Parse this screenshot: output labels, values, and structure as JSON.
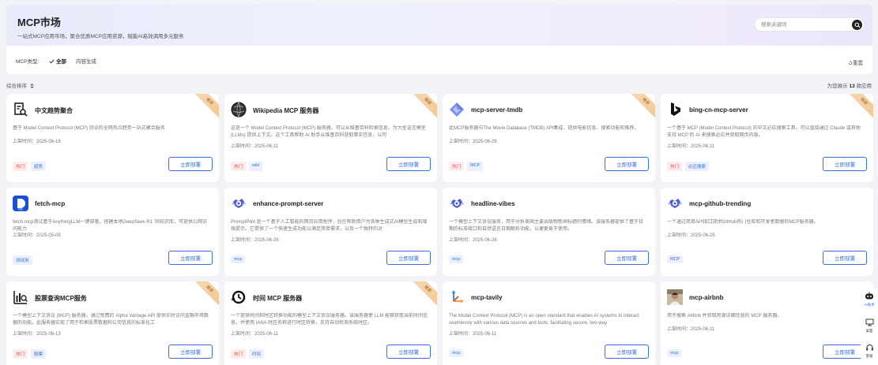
{
  "header": {
    "title": "MCP市场",
    "subtitle": "一站式MCP应用市场，聚合优质MCP应用资源，赋能AI高效调用多元服务",
    "search_placeholder": "搜索关键词"
  },
  "filter": {
    "label": "MCP类型:",
    "options": [
      {
        "label": "全部",
        "selected": true
      },
      {
        "label": "内容生成",
        "selected": false
      }
    ],
    "reset_label": "重置"
  },
  "sort_label": "综合排序",
  "count": {
    "prefix": "为您展示",
    "value": "13",
    "suffix": "款应用"
  },
  "cards": [
    {
      "title": "中文趋势聚合",
      "desc": "基于 Model Context Protocol (MCP) 协议的全网热点趋势一站式聚合服务",
      "date": "上架时间：2025-06-16",
      "tags": [
        "热门",
        "趋势"
      ],
      "ribbon": "推荐",
      "button": "立即部署",
      "icon": "trend-search-icon"
    },
    {
      "title": "Wikipedia MCP 服务器",
      "desc": "这是一个 Model Context Protocol (MCP) 服务器，可以从维基百科检索信息，为大型语言模型 (LLMs) 提供上下文。这个工具帮助 AI 助手从维基百科获取事实信息，以可",
      "date": "上架时间：2025-06-11",
      "tags": [
        "热门",
        "wiki"
      ],
      "ribbon": "推荐",
      "button": "立即部署",
      "icon": "wikipedia-globe-icon"
    },
    {
      "title": "mcp-server-tmdb",
      "desc": "此MCP服务器与The Movie Database (TMDB) API集成，提供电影信息、搜索功能和推荐。",
      "date": "上架时间：2025-06-26",
      "tags": [
        "热门",
        "MCP"
      ],
      "ribbon": "推荐",
      "button": "立即部署",
      "icon": "cube-icon"
    },
    {
      "title": "bing-cn-mcp-server",
      "desc": "一个基于 MCP (Model Context Protocol) 的中文必应搜索工具，可以直接通过 Claude 或其他支持 MCP 的 AI 来搜索必应并获取网页内容。",
      "date": "上架时间：2025-06-11",
      "tags": [
        "热门",
        "必应搜索"
      ],
      "ribbon": "推荐",
      "button": "立即部署",
      "icon": "bing-logo-icon"
    },
    {
      "title": "fetch-mcp",
      "desc": "fetch-mcp测试基于AnythingLLM一键部署，搭建本地DeepSeek-R1 7B知识库，可提供公网访问能力",
      "date": "上架时间：2025-05-09",
      "tags": [
        "测试用"
      ],
      "ribbon": "",
      "button": "立即部署",
      "icon": "dify-logo-icon"
    },
    {
      "title": "enhance-prompt-server",
      "desc": "PromptPilot 是一个基于人工智能的网页应用程序，旨在帮助用户为各种生成式AI模型生成和增强提示。它提供了一个快速生成功能以满足简单需求，以及一个独特的对",
      "date": "上架时间：2025-06-26",
      "tags": [
        "mcp"
      ],
      "ribbon": "",
      "button": "立即部署",
      "icon": "gear-cloud-icon"
    },
    {
      "title": "headline-vibes",
      "desc": "一个模型上下文协议服务，用于分析美国主要出版物新闻标题的情绪。该服务器提供了基于日期的标准接口和自然语言日期解析功能，以便更易于使用。",
      "date": "上架时间：2025-06-26",
      "tags": [
        "mcp"
      ],
      "ribbon": "",
      "button": "立即部署",
      "icon": "gear-cloud-icon"
    },
    {
      "title": "mcp-github-trending",
      "desc": "一个通过简单API接口提供GitHub热门仓库和开发者数据的MCP服务器。",
      "date": "上架时间：2025-06-25",
      "tags": [
        "MCP"
      ],
      "ribbon": "",
      "button": "立即部署",
      "icon": "gear-cloud-icon"
    },
    {
      "title": "股票查询MCP服务",
      "desc": "一个模型上下文协议 (MCP) 服务器，通过免费的 Alpha Vantage API 提供实时访问金融市场数据的功能。此服务器实现了用于检索股票数据和公司信息的标准化工",
      "date": "上架时间：2025-06-13",
      "tags": [
        "热门",
        "股票"
      ],
      "ribbon": "推荐",
      "button": "立即部署",
      "icon": "stock-chart-icon"
    },
    {
      "title": "时间 MCP 服务器",
      "desc": "一个提供时间和时区转换功能的模型上下文协议服务器。该服务器使 LLM 能够获取当前时间信息，并使用 IANA 时区名称进行时区转换，支持自动检测系统时区。",
      "date": "上架时间：2025-06-11",
      "tags": [
        "热门",
        "时间"
      ],
      "ribbon": "推荐",
      "button": "立即部署",
      "icon": "clock-icon"
    },
    {
      "title": "mcp-tavily",
      "desc": "The Model Context Protocol (MCP) is an open standard that enables AI systems to interact seamlessly with various data sources and tools, facilitating secure, two-way",
      "date": "上架时间：2025-06-11",
      "tags": [
        "mcp"
      ],
      "ribbon": "",
      "button": "立即部署",
      "icon": "tavily-logo-icon"
    },
    {
      "title": "mcp-airbnb",
      "desc": "用于搜索 Airbnb 并获取房源详细信息的 MCP 服务器。",
      "date": "上架时间：2025-06-11",
      "tags": [
        "mcp"
      ],
      "ribbon": "",
      "button": "立即部署",
      "icon": "avatar-photo-icon"
    }
  ],
  "rail": [
    {
      "label": "AI助手",
      "icon": "robot-icon",
      "active": true
    },
    {
      "label": "桌面",
      "icon": "monitor-icon",
      "active": false
    },
    {
      "label": "客服",
      "icon": "headset-icon",
      "active": false
    }
  ],
  "colors": {
    "accent": "#3a6fe0",
    "hot_tag": "#e2554e",
    "ribbon": "#f3c893"
  }
}
